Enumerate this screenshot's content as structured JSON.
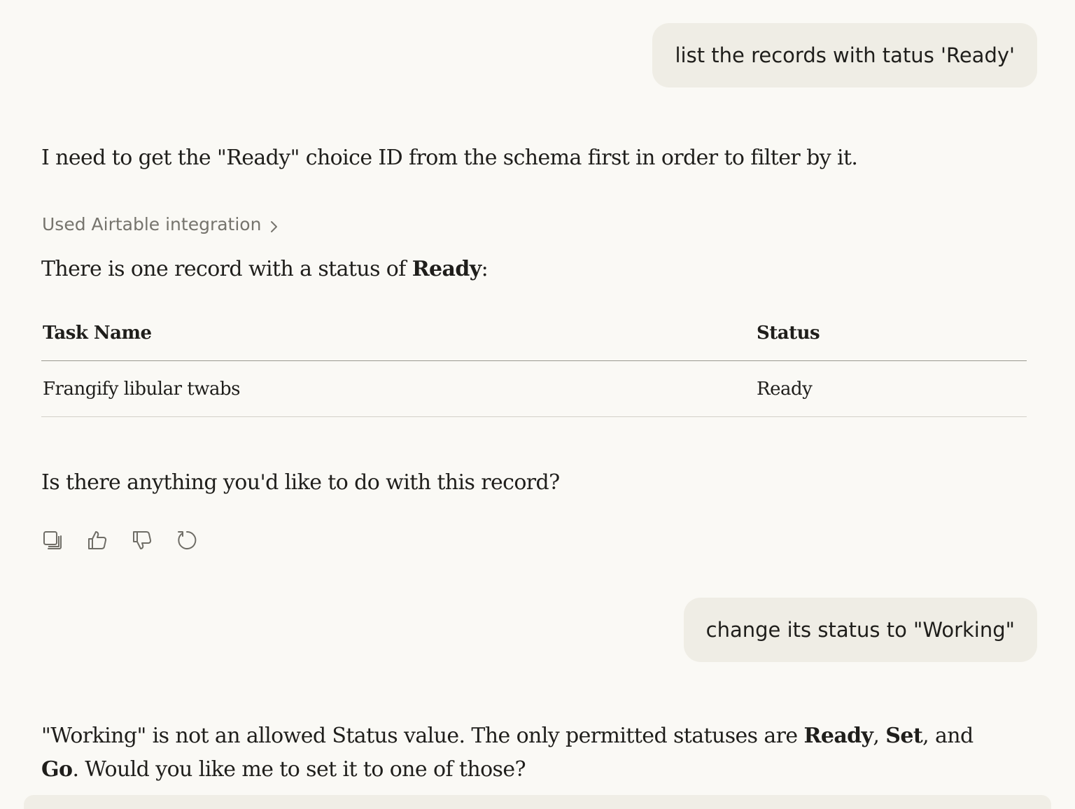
{
  "messages": {
    "user_1": "list the records with tatus 'Ready'",
    "assistant_1_intro": "I need to get the \"Ready\" choice ID from the schema first in order to filter by it.",
    "tool_usage": "Used Airtable integration",
    "assistant_1_result_prefix": "There is one record with a status of ",
    "assistant_1_result_bold": "Ready",
    "assistant_1_result_suffix": ":",
    "assistant_1_followup": "Is there anything you'd like to do with this record?",
    "user_2": "change its status to \"Working\"",
    "assistant_2": {
      "part1": "\"Working\" is not an allowed Status value. The only permitted statuses are ",
      "bold1": "Ready",
      "sep1": ", ",
      "bold2": "Set",
      "sep2": ", and ",
      "bold3": "Go",
      "part2": ". Would you like me to set it to one of those?"
    }
  },
  "table": {
    "headers": [
      "Task Name",
      "Status"
    ],
    "rows": [
      [
        "Frangify libular twabs",
        "Ready"
      ]
    ]
  },
  "actions": {
    "icons": [
      "copy-icon",
      "thumbs-up-icon",
      "thumbs-down-icon",
      "retry-icon"
    ]
  },
  "colors": {
    "background": "#faf9f5",
    "bubble": "#efede5",
    "text": "#1f1e1b",
    "muted": "#76746d"
  }
}
